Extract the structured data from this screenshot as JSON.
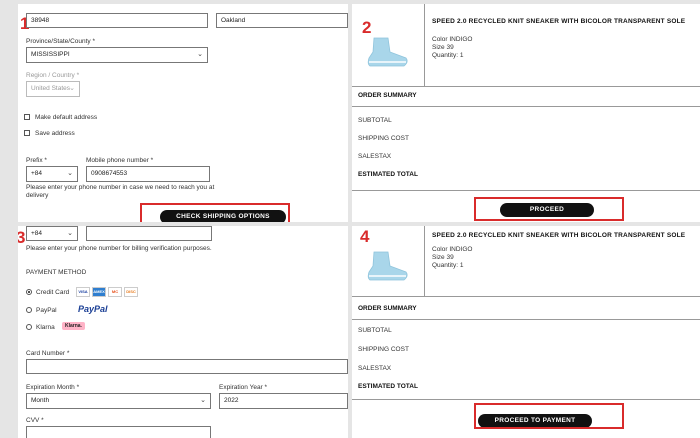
{
  "p1": {
    "step": "1",
    "postal_value": "38948",
    "city_value": "Oakland",
    "province_label": "Province/State/County *",
    "province_value": "MISSISSIPPI",
    "region_label": "Region / Country *",
    "region_value": "United States",
    "make_default": "Make default address",
    "save_address": "Save address",
    "prefix_label": "Prefix *",
    "prefix_value": "+84",
    "phone_label": "Mobile phone number *",
    "phone_value": "0908674553",
    "phone_note": "Please enter your phone number in case we need to reach you at delivery",
    "button": "CHECK SHIPPING OPTIONS"
  },
  "p2": {
    "step": "2",
    "product_title": "SPEED 2.0 RECYCLED KNIT SNEAKER WITH BICOLOR TRANSPARENT SOLE",
    "color": "Color INDIGO",
    "size": "Size 39",
    "quantity": "Quantity: 1",
    "order_summary": "ORDER SUMMARY",
    "subtotal": "SUBTOTAL",
    "shipping_cost": "SHIPPING COST",
    "salestax": "SALESTAX",
    "estimated_total": "ESTIMATED TOTAL",
    "button": "PROCEED"
  },
  "p3": {
    "step": "3",
    "prefix_value": "+84",
    "phone_note": "Please enter your phone number for billing verification purposes.",
    "payment_method": "PAYMENT METHOD",
    "credit_card": "Credit Card",
    "paypal_label": "PayPal",
    "paypal_logo": "PayPal",
    "klarna_label": "Klarna",
    "klarna_logo": "Klarna.",
    "card_logos": [
      "VISA",
      "AMEX",
      "MC",
      "DISC"
    ],
    "card_number_label": "Card Number *",
    "exp_month_label": "Expiration Month *",
    "exp_month_value": "Month",
    "exp_year_label": "Expiration Year *",
    "exp_year_value": "2022",
    "cvv_label": "CVV *"
  },
  "p4": {
    "step": "4",
    "product_title": "SPEED 2.0 RECYCLED KNIT SNEAKER WITH BICOLOR TRANSPARENT SOLE",
    "color": "Color INDIGO",
    "size": "Size 39",
    "quantity": "Quantity: 1",
    "order_summary": "ORDER SUMMARY",
    "subtotal": "SUBTOTAL",
    "shipping_cost": "SHIPPING COST",
    "salestax": "SALESTAX",
    "estimated_total": "ESTIMATED TOTAL",
    "button": "PROCEED TO PAYMENT"
  },
  "colors": {
    "highlight": "#d92b2b",
    "button": "#111111",
    "sneaker": "#a9d6ea"
  },
  "icons": [
    "chevron-down-icon",
    "sneaker-image",
    "radio-icon",
    "checkbox-icon"
  ]
}
